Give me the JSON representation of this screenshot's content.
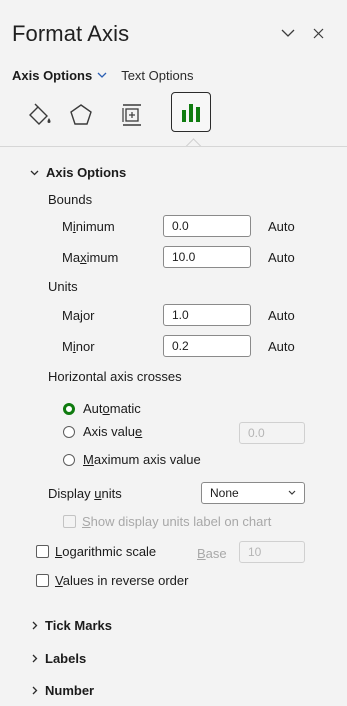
{
  "header": {
    "title": "Format Axis",
    "menu_icon": "chevron-down-icon",
    "close_icon": "close-icon"
  },
  "subtabs": {
    "axis_options": "Axis Options",
    "text_options": "Text Options"
  },
  "category_icons": [
    "fill-line-icon",
    "effects-icon",
    "size-properties-icon",
    "axis-options-icon"
  ],
  "sections": {
    "axis_options": "Axis Options",
    "tick_marks": "Tick Marks",
    "labels": "Labels",
    "number": "Number"
  },
  "bounds": {
    "label": "Bounds",
    "minimum_label": "Minimum",
    "minimum_value": "0.0",
    "maximum_label": "Maximum",
    "maximum_value": "10.0",
    "auto_label": "Auto"
  },
  "units": {
    "label": "Units",
    "major_label": "Major",
    "major_value": "1.0",
    "minor_label": "Minor",
    "minor_value": "0.2",
    "auto_label": "Auto"
  },
  "crosses": {
    "label": "Horizontal axis crosses",
    "automatic": "Automatic",
    "axis_value": "Axis value",
    "axis_value_field": "0.0",
    "maximum": "Maximum axis value"
  },
  "display_units": {
    "label": "Display units",
    "selected": "None",
    "show_label": "Show display units label on chart"
  },
  "log_scale": {
    "label": "Logarithmic scale",
    "base_label": "Base",
    "base_value": "10"
  },
  "reverse_order": {
    "label": "Values in reverse order"
  },
  "colors": {
    "accent_green": "#0f7b0f",
    "chart_green": "#107c10"
  }
}
